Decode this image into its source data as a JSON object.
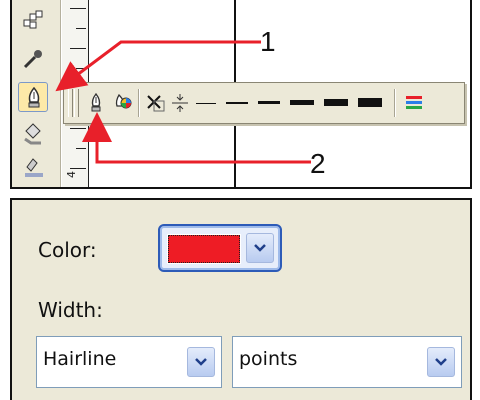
{
  "annotations": {
    "callout_1": "1",
    "callout_2": "2"
  },
  "toolbox": {
    "tools": [
      {
        "icon": "shape-tool-icon"
      },
      {
        "icon": "eyedropper-icon"
      },
      {
        "icon": "outline-pen-icon",
        "active": true
      },
      {
        "icon": "fill-bucket-icon"
      },
      {
        "icon": "interactive-fill-icon"
      }
    ]
  },
  "ruler": {
    "label": "4"
  },
  "outline_flyout": {
    "items": [
      {
        "icon": "outline-pen-dialog-icon"
      },
      {
        "icon": "outline-color-icon"
      },
      {
        "icon": "no-outline-icon"
      },
      {
        "icon": "hairline-outline-icon"
      }
    ],
    "line_widths": [
      "hairline",
      "thin",
      "medium",
      "thick",
      "heavy",
      "extra-heavy"
    ],
    "colors": {
      "annotation": "#e8202a",
      "swatch": "#ee1c25",
      "accent": "#2d5bb8"
    }
  },
  "outline_dialog": {
    "color_label": "Color:",
    "width_label": "Width:",
    "color_value": "#ee1c25",
    "width_select": {
      "value": "Hairline"
    },
    "units_select": {
      "value": "points"
    }
  }
}
